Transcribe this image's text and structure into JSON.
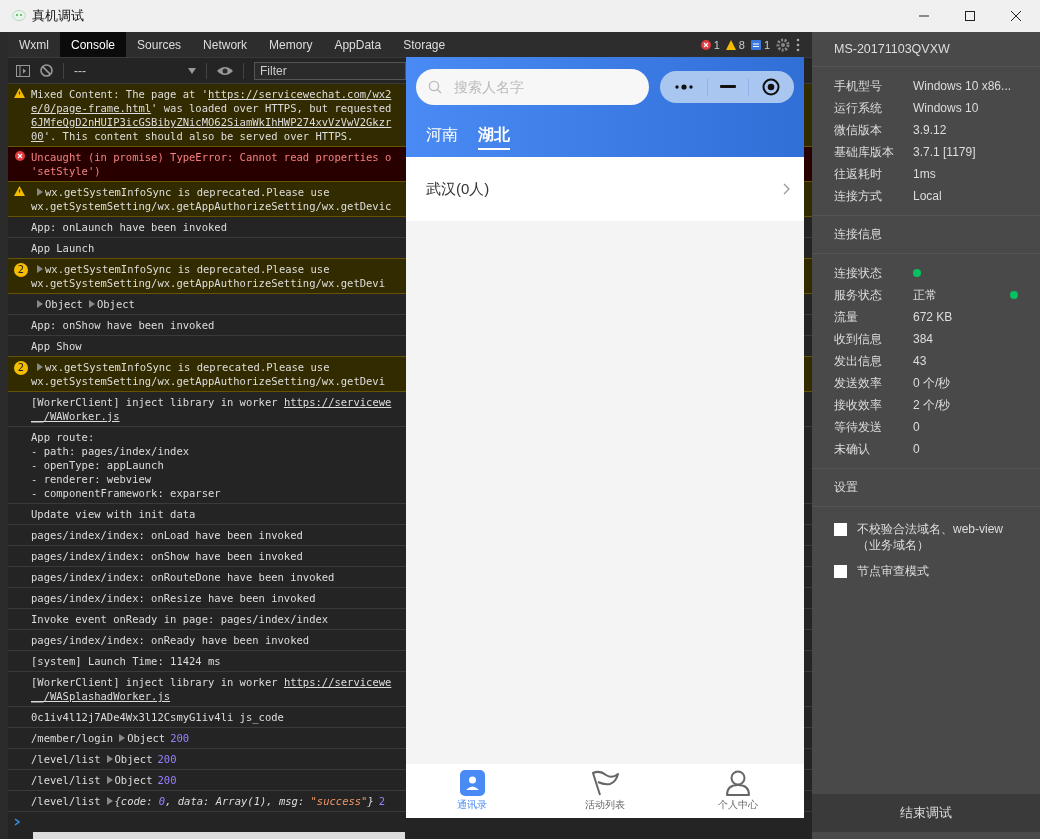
{
  "window": {
    "title": "真机调试"
  },
  "devtools": {
    "tabs": [
      {
        "label": "Wxml",
        "selected": false
      },
      {
        "label": "Console",
        "selected": true
      },
      {
        "label": "Sources",
        "selected": false
      },
      {
        "label": "Network",
        "selected": false
      },
      {
        "label": "Memory",
        "selected": false
      },
      {
        "label": "AppData",
        "selected": false
      },
      {
        "label": "Storage",
        "selected": false
      }
    ],
    "counters": [
      {
        "kind": "error",
        "count": "1"
      },
      {
        "kind": "warning",
        "count": "8"
      },
      {
        "kind": "info",
        "count": "1"
      }
    ],
    "toolbar": {
      "context": "---",
      "filter_placeholder": "Filter"
    },
    "console": [
      {
        "kind": "warning",
        "lines": [
          [
            {
              "kind": "text",
              "text": "Mixed Content: The page at '"
            },
            {
              "kind": "link",
              "text": "https://servicewechat.com/wx2"
            }
          ],
          [
            {
              "kind": "link",
              "text": "e/0/page-frame.html"
            },
            {
              "kind": "text",
              "text": "' was loaded over HTTPS, but requested"
            }
          ],
          [
            {
              "kind": "link",
              "text": "6JMfeQgD2nHUIP3icGSBibyZNicMO62SiamWkIhHWP274xvVzVwV2Gkzr"
            }
          ],
          [
            {
              "kind": "link",
              "text": "00"
            },
            {
              "kind": "text",
              "text": "'. This content should also be served over HTTPS."
            }
          ]
        ]
      },
      {
        "kind": "error",
        "lines": [
          [
            {
              "kind": "text",
              "text": "Uncaught (in promise) TypeError: Cannot read properties o"
            }
          ],
          [
            {
              "kind": "text",
              "text": "'setStyle')"
            }
          ]
        ]
      },
      {
        "kind": "warning",
        "lines": [
          [
            {
              "kind": "toggle",
              "text": "wx.getSystemInfoSync is deprecated.Please use"
            }
          ],
          [
            {
              "kind": "text",
              "text": "wx.getSystemSetting/wx.getAppAuthorizeSetting/wx.getDevic"
            }
          ]
        ]
      },
      {
        "kind": "log",
        "lines": [
          [
            {
              "kind": "text",
              "text": "App: onLaunch have been invoked"
            }
          ]
        ]
      },
      {
        "kind": "log",
        "lines": [
          [
            {
              "kind": "text",
              "text": "App Launch"
            }
          ]
        ]
      },
      {
        "kind": "warning",
        "count": "2",
        "lines": [
          [
            {
              "kind": "toggle",
              "text": "wx.getSystemInfoSync is deprecated.Please use"
            }
          ],
          [
            {
              "kind": "text",
              "text": "wx.getSystemSetting/wx.getAppAuthorizeSetting/wx.getDevi"
            }
          ]
        ]
      },
      {
        "kind": "log",
        "lines": [
          [
            {
              "kind": "toggle",
              "text": "Object"
            },
            {
              "kind": "toggle",
              "text": "Object"
            }
          ]
        ]
      },
      {
        "kind": "log",
        "lines": [
          [
            {
              "kind": "text",
              "text": "App: onShow have been invoked"
            }
          ]
        ]
      },
      {
        "kind": "log",
        "lines": [
          [
            {
              "kind": "text",
              "text": "App Show"
            }
          ]
        ]
      },
      {
        "kind": "warning",
        "count": "2",
        "lines": [
          [
            {
              "kind": "toggle",
              "text": "wx.getSystemInfoSync is deprecated.Please use"
            }
          ],
          [
            {
              "kind": "text",
              "text": "wx.getSystemSetting/wx.getAppAuthorizeSetting/wx.getDevi"
            }
          ]
        ]
      },
      {
        "kind": "log",
        "lines": [
          [
            {
              "kind": "text",
              "text": "[WorkerClient] inject library in worker "
            },
            {
              "kind": "link",
              "text": "https://servicewe"
            }
          ],
          [
            {
              "kind": "link",
              "text": "__/WAWorker.js"
            }
          ]
        ]
      },
      {
        "kind": "log",
        "lines": [
          [
            {
              "kind": "text",
              "text": "App route:"
            }
          ],
          [
            {
              "kind": "text",
              "text": "- path: pages/index/index"
            }
          ],
          [
            {
              "kind": "text",
              "text": "- openType: appLaunch"
            }
          ],
          [
            {
              "kind": "text",
              "text": "- renderer: webview"
            }
          ],
          [
            {
              "kind": "text",
              "text": "- componentFramework: exparser"
            }
          ]
        ]
      },
      {
        "kind": "log",
        "lines": [
          [
            {
              "kind": "text",
              "text": "Update view with init data"
            }
          ]
        ]
      },
      {
        "kind": "log",
        "lines": [
          [
            {
              "kind": "text",
              "text": "pages/index/index: onLoad have been invoked"
            }
          ]
        ]
      },
      {
        "kind": "log",
        "lines": [
          [
            {
              "kind": "text",
              "text": "pages/index/index: onShow have been invoked"
            }
          ]
        ]
      },
      {
        "kind": "log",
        "lines": [
          [
            {
              "kind": "text",
              "text": "pages/index/index: onRouteDone have been invoked"
            }
          ]
        ]
      },
      {
        "kind": "log",
        "lines": [
          [
            {
              "kind": "text",
              "text": "pages/index/index: onResize have been invoked"
            }
          ]
        ]
      },
      {
        "kind": "log",
        "lines": [
          [
            {
              "kind": "text",
              "text": "Invoke event onReady in page: pages/index/index"
            }
          ]
        ]
      },
      {
        "kind": "log",
        "lines": [
          [
            {
              "kind": "text",
              "text": "pages/index/index: onReady have been invoked"
            }
          ]
        ]
      },
      {
        "kind": "log",
        "lines": [
          [
            {
              "kind": "text",
              "text": "[system] Launch Time: 11424 ms"
            }
          ]
        ]
      },
      {
        "kind": "log",
        "lines": [
          [
            {
              "kind": "text",
              "text": "[WorkerClient] inject library in worker "
            },
            {
              "kind": "link",
              "text": "https://servicewe"
            }
          ],
          [
            {
              "kind": "link",
              "text": "__/WASplashadWorker.js"
            }
          ]
        ]
      },
      {
        "kind": "log",
        "lines": [
          [
            {
              "kind": "text",
              "text": "0c1iv4l12j7ADe4Wx3l12CsmyG1iv4li js_code"
            }
          ]
        ]
      },
      {
        "kind": "log",
        "lines": [
          [
            {
              "kind": "text",
              "text": "/member/login"
            },
            {
              "kind": "toggle",
              "text": "Object"
            },
            {
              "kind": "num",
              "text": "200"
            }
          ]
        ]
      },
      {
        "kind": "log",
        "lines": [
          [
            {
              "kind": "text",
              "text": "/level/list"
            },
            {
              "kind": "toggle",
              "text": "Object"
            },
            {
              "kind": "num",
              "text": "200"
            }
          ]
        ]
      },
      {
        "kind": "log",
        "lines": [
          [
            {
              "kind": "text",
              "text": "/level/list"
            },
            {
              "kind": "toggle",
              "text": "Object"
            },
            {
              "kind": "num",
              "text": "200"
            }
          ]
        ]
      },
      {
        "kind": "log",
        "lines": [
          [
            {
              "kind": "text",
              "text": "/level/list"
            },
            {
              "kind": "toggle_obj",
              "text": "{code: "
            },
            {
              "kind": "obj_num",
              "text": "0"
            },
            {
              "kind": "obj",
              "text": ", data: Array(1), msg: "
            },
            {
              "kind": "obj_str",
              "text": "\"success\""
            },
            {
              "kind": "obj",
              "text": "}"
            },
            {
              "kind": "num",
              "text": "2"
            }
          ]
        ]
      }
    ]
  },
  "phone": {
    "search_placeholder": "搜索人名字",
    "tabs": [
      {
        "label": "河南",
        "selected": false
      },
      {
        "label": "湖北",
        "selected": true
      }
    ],
    "list": [
      {
        "label": "武汉(0人)"
      }
    ],
    "tabbar": [
      {
        "label": "通讯录",
        "kind": "contacts",
        "selected": true
      },
      {
        "label": "活动列表",
        "kind": "flag",
        "selected": false
      },
      {
        "label": "个人中心",
        "kind": "person",
        "selected": false
      }
    ]
  },
  "device_panel": {
    "device_name": "MS-20171103QVXW",
    "info": [
      {
        "label": "手机型号",
        "value": "Windows 10 x86..."
      },
      {
        "label": "运行系统",
        "value": "Windows 10"
      },
      {
        "label": "微信版本",
        "value": "3.9.12"
      },
      {
        "label": "基础库版本",
        "value": "3.7.1 [1179]"
      },
      {
        "label": "往返耗时",
        "value": "1ms"
      },
      {
        "label": "连接方式",
        "value": "Local"
      }
    ],
    "connection_title": "连接信息",
    "connection": [
      {
        "label": "连接状态",
        "kind": "dot",
        "ok": true
      },
      {
        "label": "服务状态",
        "kind": "text_dot",
        "value": "正常",
        "ok": true
      },
      {
        "label": "流量",
        "kind": "text",
        "value": "672 KB"
      },
      {
        "label": "收到信息",
        "kind": "text",
        "value": "384"
      },
      {
        "label": "发出信息",
        "kind": "text",
        "value": "43"
      },
      {
        "label": "发送效率",
        "kind": "text",
        "value": "0 个/秒"
      },
      {
        "label": "接收效率",
        "kind": "text",
        "value": "2 个/秒"
      },
      {
        "label": "等待发送",
        "kind": "text",
        "value": "0"
      },
      {
        "label": "未确认",
        "kind": "text",
        "value": "0"
      }
    ],
    "settings_title": "设置",
    "settings": [
      {
        "label": "不校验合法域名、web-view（业务域名）",
        "checked": false
      },
      {
        "label": "节点审查模式",
        "checked": false
      }
    ],
    "end_button": "结束调试"
  }
}
